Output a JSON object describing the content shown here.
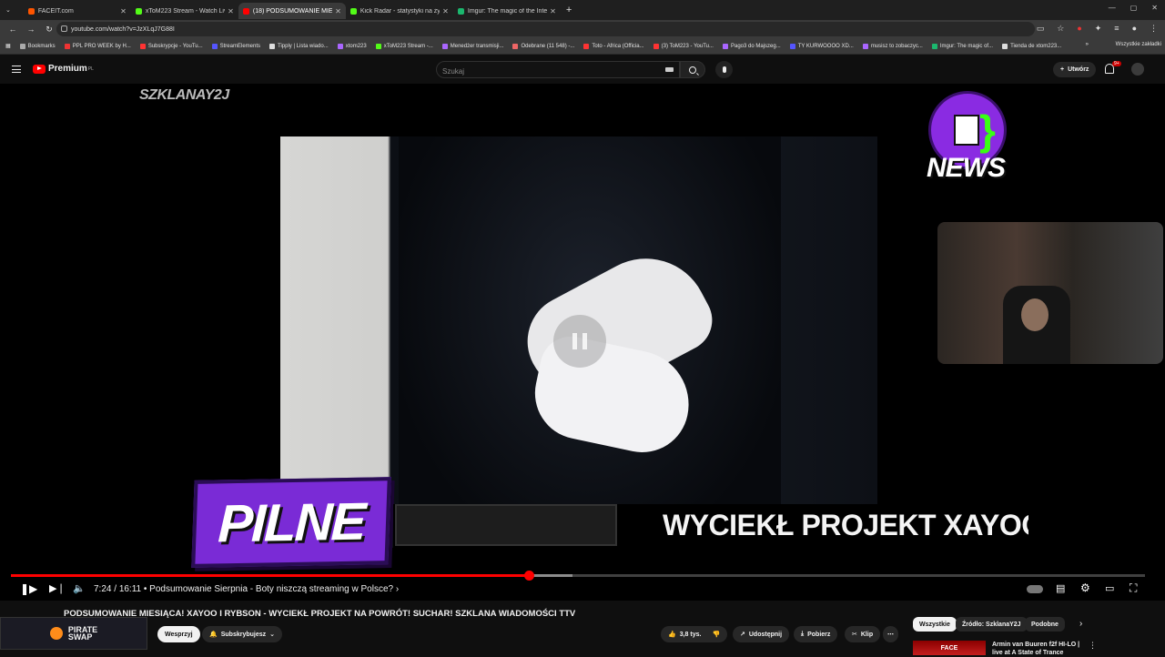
{
  "tabs": [
    {
      "title": "FACEIT.com",
      "color": "#ff5500",
      "active": false
    },
    {
      "title": "xToM223 Stream - Watch Live o...",
      "color": "#53fc18",
      "active": false
    },
    {
      "title": "(18) PODSUMOWANIE MIE...",
      "color": "#ff0000",
      "active": true
    },
    {
      "title": "Kick Radar - statystyki na żywo!",
      "color": "#53fc18",
      "active": false
    },
    {
      "title": "Imgur: The magic of the Interne...",
      "color": "#1bb76e",
      "active": false
    }
  ],
  "url": "youtube.com/watch?v=JzXLqJ7G88I",
  "bookmarks": [
    "Bookmarks",
    "PPL PRO WEEK by H...",
    "Subskrypcje - YouTu...",
    "StreamElements",
    "Tipply | Lista wiado...",
    "xtom223",
    "xToM223 Stream -...",
    "Menedżer transmisji...",
    "Odebrane (11 548) -...",
    "Toto - Africa (Officia...",
    "(3) ToM223 - YouTu...",
    "Pago3 do Majszeg...",
    "TY KURWOOOO XD...",
    "musisz to zobaczyc...",
    "Imgur: The magic of...",
    "Tienda de xtom223..."
  ],
  "bookmarks_end": "Wszystkie zakładki",
  "yt": {
    "logo": "Premium",
    "region": "PL",
    "search_placeholder": "Szukaj",
    "create": "Utwórz",
    "notif_count": "9+"
  },
  "video": {
    "watermark": "SZKLANAY2J",
    "brand": "NEWS",
    "pilne": "PILNE",
    "ticker": "WYCIEKŁ PROJEKT XAYOO NA",
    "current_time": "7:24",
    "duration": "16:11",
    "chapter": "Podsumowanie Sierpnia - Boty niszczą streaming w Polsce?",
    "progress": 0.457,
    "buffered": 0.495
  },
  "title": "PODSUMOWANIE MIESIĄCA! XAYOO I RYBSON - WYCIEKŁ PROJEKT NA POWRÓT! SUCHAR! SZKLANA WIADOMOŚCI TTV",
  "sponsor": {
    "line1": "PIRATE",
    "line2": "SWAP"
  },
  "actions": {
    "support": "Wesprzyj",
    "subscribed": "Subskrybujesz",
    "likes": "3,8 tys.",
    "share": "Udostępnij",
    "download": "Pobierz",
    "clip": "Klip"
  },
  "chips": [
    "Wszystkie",
    "Źródło: SzklanaY2J",
    "Podobne"
  ],
  "related": {
    "thumb_text": "FACE",
    "title": "Armin van Buuren f2f HI-LO | live at A State of Trance"
  }
}
